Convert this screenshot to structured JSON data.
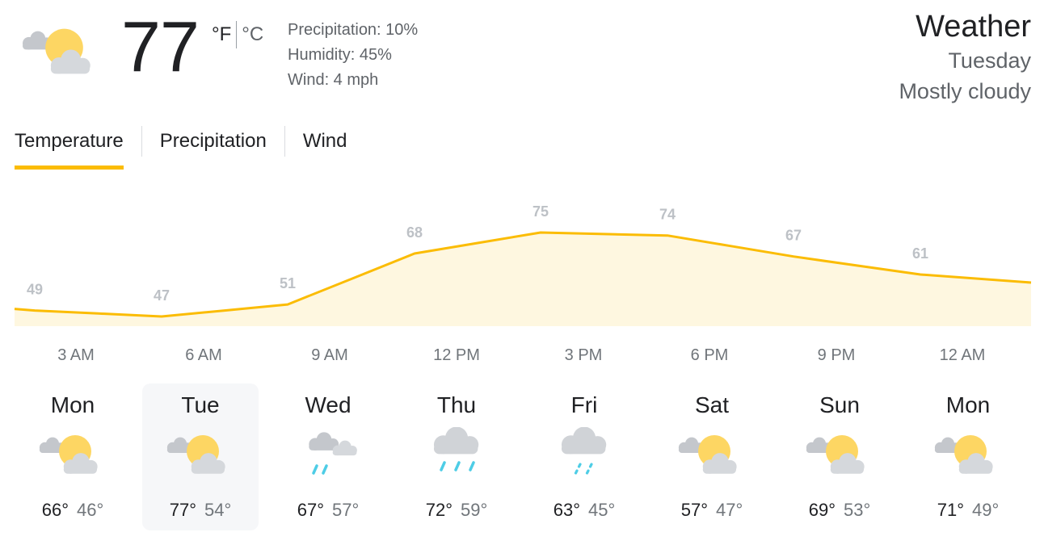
{
  "header": {
    "icon": "partly-cloudy-icon",
    "temperature": "77",
    "unit_f": "°F",
    "unit_c": "°C",
    "precipitation": "Precipitation: 10%",
    "humidity": "Humidity: 45%",
    "wind": "Wind: 4 mph",
    "title": "Weather",
    "day": "Tuesday",
    "condition": "Mostly cloudy"
  },
  "tabs": [
    {
      "label": "Temperature",
      "active": true
    },
    {
      "label": "Precipitation",
      "active": false
    },
    {
      "label": "Wind",
      "active": false
    }
  ],
  "chart_data": {
    "type": "area",
    "series": [
      {
        "values": [
          49,
          47,
          51,
          68,
          75,
          74,
          67,
          61
        ]
      }
    ],
    "categories": [
      "3 AM",
      "6 AM",
      "9 AM",
      "12 PM",
      "3 PM",
      "6 PM",
      "9 PM",
      "12 AM"
    ],
    "data_labels": [
      "49",
      "47",
      "51",
      "68",
      "75",
      "74",
      "67",
      "61"
    ],
    "line_color": "#fbbc04",
    "fill_color": "#fef7e0",
    "label_color": "#bdc1c6",
    "ylim": [
      47,
      75
    ],
    "grid": false
  },
  "time_labels": [
    "3 AM",
    "6 AM",
    "9 AM",
    "12 PM",
    "3 PM",
    "6 PM",
    "9 PM",
    "12 AM"
  ],
  "forecast": [
    {
      "day": "Mon",
      "icon": "partly-cloudy-icon",
      "high": "66°",
      "low": "46°",
      "selected": false
    },
    {
      "day": "Tue",
      "icon": "partly-cloudy-icon",
      "high": "77°",
      "low": "54°",
      "selected": true
    },
    {
      "day": "Wed",
      "icon": "rain-cloudy-icon",
      "high": "67°",
      "low": "57°",
      "selected": false
    },
    {
      "day": "Thu",
      "icon": "rain-icon",
      "high": "72°",
      "low": "59°",
      "selected": false
    },
    {
      "day": "Fri",
      "icon": "light-rain-icon",
      "high": "63°",
      "low": "45°",
      "selected": false
    },
    {
      "day": "Sat",
      "icon": "partly-cloudy-icon",
      "high": "57°",
      "low": "47°",
      "selected": false
    },
    {
      "day": "Sun",
      "icon": "partly-cloudy-icon",
      "high": "69°",
      "low": "53°",
      "selected": false
    },
    {
      "day": "Mon",
      "icon": "partly-cloudy-icon",
      "high": "71°",
      "low": "49°",
      "selected": false
    }
  ],
  "colors": {
    "accent": "#fbbc04",
    "sun": "#fdd663",
    "cloud": "#dadce0",
    "rain": "#4ecde6"
  }
}
